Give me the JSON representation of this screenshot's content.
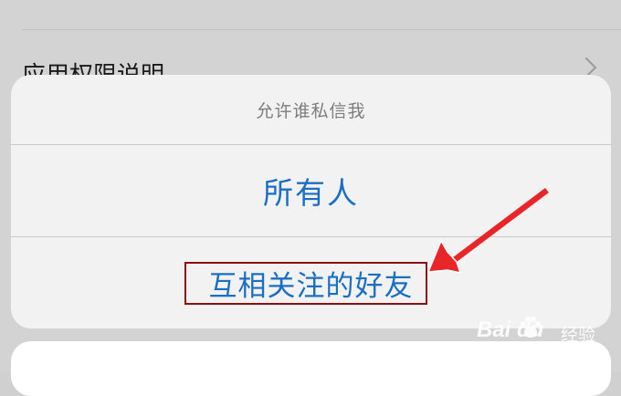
{
  "background": {
    "row_label": "应用权限说明"
  },
  "action_sheet": {
    "title": "允许谁私信我",
    "options": [
      {
        "label": "所有人"
      },
      {
        "label": "互相关注的好友",
        "highlighted": true
      }
    ]
  },
  "annotation": {
    "arrow_color": "#e8262a",
    "box_color": "#8b0f0f"
  },
  "watermark": {
    "logo": "Bai  du",
    "cn": "经验",
    "url": "jingyan.baidu.com"
  },
  "colors": {
    "option_text": "#1a6fc4",
    "title_text": "#7d7d7d",
    "sheet_bg": "#f2f2f2",
    "overlay_bg": "#d3d3d3"
  }
}
